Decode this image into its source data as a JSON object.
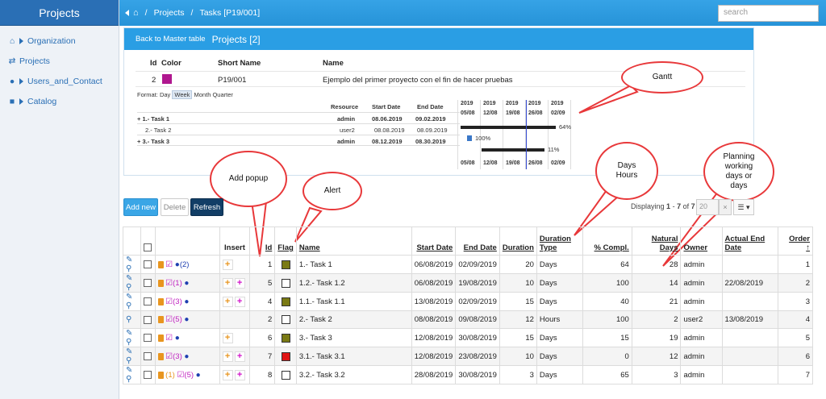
{
  "sidebar": {
    "title": "Projects",
    "items": [
      {
        "label": "Organization",
        "icon": "sitemap-icon"
      },
      {
        "label": "Projects",
        "icon": "shuffle-icon"
      },
      {
        "label": "Users_and_Contact",
        "icon": "user-icon"
      },
      {
        "label": "Catalog",
        "icon": "book-icon"
      }
    ]
  },
  "topbar": {
    "crumb1": "Projects",
    "crumb2": "Tasks [P19/001]",
    "sep": "/",
    "search_placeholder": "search"
  },
  "master": {
    "back_label": "Back to Master table",
    "title": "Projects [2]",
    "headers": {
      "id": "Id",
      "color": "Color",
      "short_name": "Short Name",
      "name": "Name"
    },
    "row": {
      "id": "2",
      "color": "#b0178f",
      "short_name": "P19/001",
      "name": "Ejemplo del primer proyecto con el fin de hacer pruebas"
    }
  },
  "gantt": {
    "format_label": "Format:",
    "formats": [
      "Day",
      "Week",
      "Month",
      "Quarter"
    ],
    "selected_format": "Week",
    "headers": {
      "resource": "Resource",
      "start": "Start Date",
      "end": "End Date"
    },
    "years": [
      "2019",
      "2019",
      "2019",
      "2019",
      "2019"
    ],
    "weeks": [
      "05/08",
      "12/08",
      "19/08",
      "26/08",
      "02/09"
    ],
    "rows": [
      {
        "name": "+ 1.- Task 1",
        "resource": "admin",
        "start": "08.06.2019",
        "end": "09.02.2019",
        "pct": "64%"
      },
      {
        "name": "2.- Task 2",
        "resource": "user2",
        "start": "08.08.2019",
        "end": "08.09.2019",
        "pct": "100%"
      },
      {
        "name": "+ 3.- Task 3",
        "resource": "admin",
        "start": "08.12.2019",
        "end": "08.30.2019",
        "pct": "11%"
      }
    ]
  },
  "annotations": {
    "gantt": "Gantt",
    "add_popup": "Add popup",
    "alert": "Alert",
    "days_hours": "Days\nHours",
    "planning": "Planning\nworking\ndays or\ndays"
  },
  "toolbar": {
    "add": "Add new",
    "delete": "Delete",
    "refresh": "Refresh",
    "paging_prefix": "Displaying",
    "paging_from": "1",
    "paging_to": "7",
    "paging_of": "of",
    "paging_total": "7",
    "page_size": "20",
    "clear": "×",
    "list_icon": "list-icon"
  },
  "grid": {
    "headers": {
      "insert": "Insert",
      "id": "Id",
      "flag": "Flag",
      "name": "Name",
      "start": "Start Date",
      "end": "End Date",
      "duration": "Duration",
      "duration_type": "Duration Type",
      "compl": "% Compl.",
      "natural_days": "Natural Days",
      "owner": "Owner",
      "actual_end": "Actual End Date",
      "order": "Order"
    },
    "rows": [
      {
        "id": "1",
        "flag": "#7a7a14",
        "name": "1.- Task 1",
        "start": "06/08/2019",
        "end": "02/09/2019",
        "duration": "20",
        "dtype": "Days",
        "compl": "64",
        "natural": "28",
        "owner": "admin",
        "actual_end": "",
        "order": "1",
        "edit": true,
        "c_orange": "",
        "c_pink": "",
        "c_blue": "(2)",
        "ins_o": true,
        "ins_p": false
      },
      {
        "id": "5",
        "flag": "#ffffff",
        "name": "1.2.- Task 1.2",
        "start": "06/08/2019",
        "end": "19/08/2019",
        "duration": "10",
        "dtype": "Days",
        "compl": "100",
        "natural": "14",
        "owner": "admin",
        "actual_end": "22/08/2019",
        "order": "2",
        "edit": true,
        "c_orange": "",
        "c_pink": "(1)",
        "c_blue": "",
        "ins_o": true,
        "ins_p": true
      },
      {
        "id": "4",
        "flag": "#7a7a14",
        "name": "1.1.- Task 1.1",
        "start": "13/08/2019",
        "end": "02/09/2019",
        "duration": "15",
        "dtype": "Days",
        "compl": "40",
        "natural": "21",
        "owner": "admin",
        "actual_end": "",
        "order": "3",
        "edit": true,
        "c_orange": "",
        "c_pink": "(3)",
        "c_blue": "",
        "ins_o": true,
        "ins_p": true
      },
      {
        "id": "2",
        "flag": "#ffffff",
        "name": "2.- Task 2",
        "start": "08/08/2019",
        "end": "09/08/2019",
        "duration": "12",
        "dtype": "Hours",
        "compl": "100",
        "natural": "2",
        "owner": "user2",
        "actual_end": "13/08/2019",
        "order": "4",
        "edit": false,
        "c_orange": "",
        "c_pink": "(5)",
        "c_blue": "",
        "ins_o": false,
        "ins_p": false
      },
      {
        "id": "6",
        "flag": "#7a7a14",
        "name": "3.- Task 3",
        "start": "12/08/2019",
        "end": "30/08/2019",
        "duration": "15",
        "dtype": "Days",
        "compl": "15",
        "natural": "19",
        "owner": "admin",
        "actual_end": "",
        "order": "5",
        "edit": true,
        "c_orange": "",
        "c_pink": "",
        "c_blue": "",
        "ins_o": true,
        "ins_p": false
      },
      {
        "id": "7",
        "flag": "#e01515",
        "name": "3.1.- Task 3.1",
        "start": "12/08/2019",
        "end": "23/08/2019",
        "duration": "10",
        "dtype": "Days",
        "compl": "0",
        "natural": "12",
        "owner": "admin",
        "actual_end": "",
        "order": "6",
        "edit": true,
        "c_orange": "",
        "c_pink": "(3)",
        "c_blue": "",
        "ins_o": true,
        "ins_p": true
      },
      {
        "id": "8",
        "flag": "#ffffff",
        "name": "3.2.- Task 3.2",
        "start": "28/08/2019",
        "end": "30/08/2019",
        "duration": "3",
        "dtype": "Days",
        "compl": "65",
        "natural": "3",
        "owner": "admin",
        "actual_end": "",
        "order": "7",
        "edit": true,
        "c_orange": "(1)",
        "c_pink": "(5)",
        "c_blue": "",
        "ins_o": true,
        "ins_p": true
      }
    ]
  }
}
